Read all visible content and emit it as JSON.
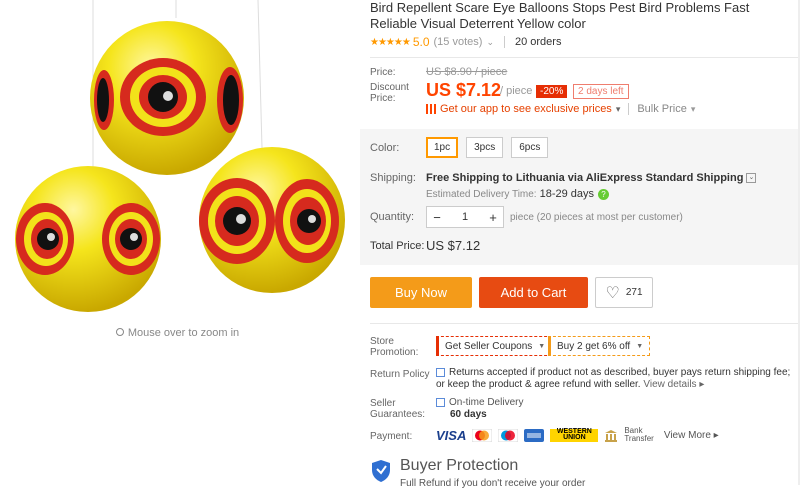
{
  "product": {
    "title": "Bird Repellent Scare Eye Balloons Stops Pest Bird Problems Fast Reliable Visual Deterrent Yellow color",
    "stars": "★★★★★",
    "rating": "5.0",
    "votes": "(15 votes)",
    "orders": "20 orders"
  },
  "gallery": {
    "zoom_hint": "Mouse over to zoom in"
  },
  "price": {
    "price_label": "Price:",
    "old_price": "US $8.90 / piece",
    "discount_label": "Discount Price:",
    "current_price": "US $7.12",
    "per_unit": "/ piece",
    "discount_badge": "-20%",
    "days_left": "2 days left",
    "app_link": "Get our app to see exclusive prices",
    "bulk_price": "Bulk Price"
  },
  "options": {
    "color_label": "Color:",
    "items": [
      "1pc",
      "3pcs",
      "6pcs"
    ],
    "selected": "1pc"
  },
  "shipping": {
    "label": "Shipping:",
    "main": "Free Shipping to Lithuania via AliExpress Standard Shipping",
    "eta_label": "Estimated Delivery Time:",
    "eta_value": "18-29 days"
  },
  "quantity": {
    "label": "Quantity:",
    "value": "1",
    "minus": "−",
    "plus": "+",
    "note": "piece (20 pieces at most per customer)"
  },
  "total": {
    "label": "Total Price:",
    "value": "US $7.12"
  },
  "actions": {
    "buy_now": "Buy Now",
    "add_to_cart": "Add to Cart",
    "wishlist_count": "271"
  },
  "store_promotion": {
    "label": "Store Promotion:",
    "coupon1": "Get Seller Coupons",
    "coupon2": "Buy 2 get 6% off"
  },
  "return_policy": {
    "label": "Return Policy",
    "text": "Returns accepted if product not as described, buyer pays return shipping fee; or keep the product & agree refund with seller.",
    "view_details": "View details ▸"
  },
  "seller_guarantees": {
    "label": "Seller Guarantees:",
    "line1": "On-time Delivery",
    "line2": "60 days"
  },
  "payment": {
    "label": "Payment:",
    "visa": "VISA",
    "western_union_1": "WESTERN",
    "western_union_2": "UNION",
    "bank_1": "Bank",
    "bank_2": "Transfer",
    "view_more": "View More ▸"
  },
  "buyer_protection": {
    "title": "Buyer Protection",
    "sub": "Full Refund if you don't receive your order"
  },
  "colors": {
    "accent": "#ff4400",
    "buy_now": "#f49b19",
    "add_to_cart": "#e74b12",
    "balloon_yellow": "#f2e21a"
  }
}
